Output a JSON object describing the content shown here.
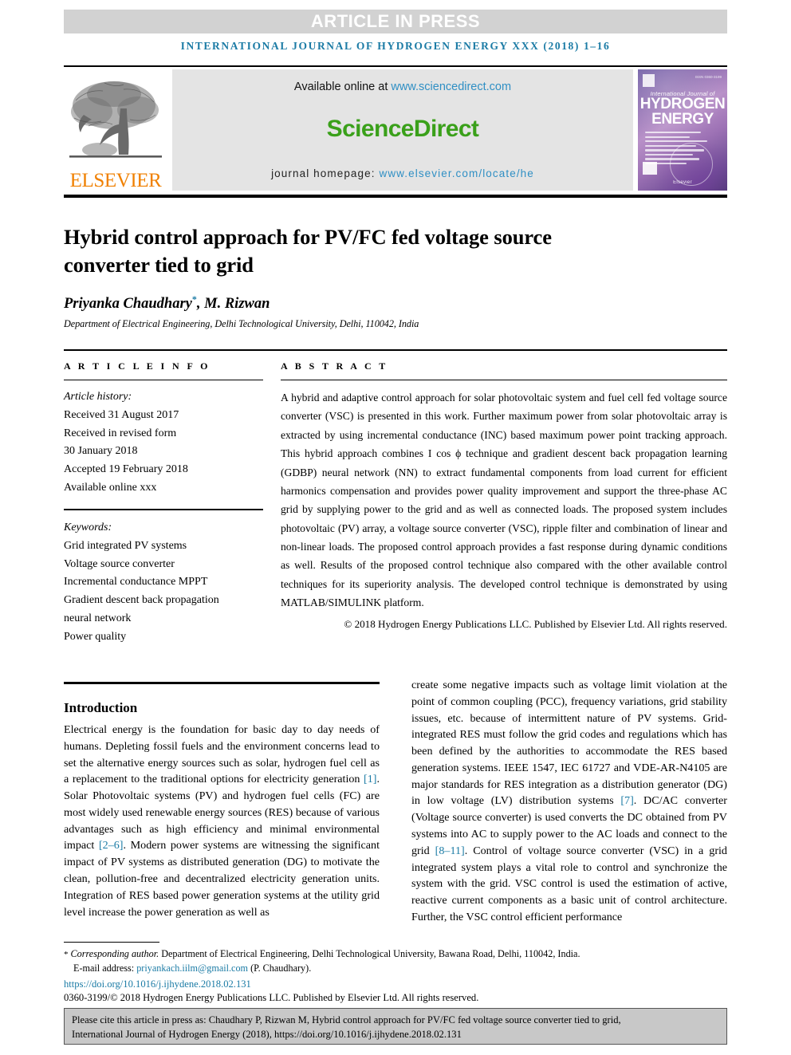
{
  "banner": {
    "press_label": "ARTICLE IN PRESS",
    "banner_color": "#d2d2d2"
  },
  "running_head": "INTERNATIONAL JOURNAL OF HYDROGEN ENERGY XXX (2018) 1–16",
  "masthead": {
    "publisher_wordmark": "ELSEVIER",
    "publisher_color": "#f08000",
    "available_prefix": "Available online at ",
    "available_url": "www.sciencedirect.com",
    "sciencedirect_wordmark": "ScienceDirect",
    "sciencedirect_color": "#3aa01a",
    "homepage_prefix": "journal homepage: ",
    "homepage_url": "www.elsevier.com/locate/he",
    "link_color": "#2f8fc4",
    "cover": {
      "line1": "International Journal of",
      "line2": "HYDROGEN",
      "line3": "ENERGY",
      "publisher": "Elsevier",
      "corner_code": "ISSN 0360-3199"
    }
  },
  "article": {
    "title": "Hybrid control approach for PV/FC fed voltage source converter tied to grid",
    "authors": "Priyanka Chaudhary",
    "corresponding_marker": "*",
    "authors_rest": ", M. Rizwan",
    "affiliation": "Department of Electrical Engineering, Delhi Technological University, Delhi, 110042, India"
  },
  "info": {
    "heading": "A R T I C L E   I N F O",
    "history_label": "Article history:",
    "history": [
      "Received 31 August 2017",
      "Received in revised form",
      "30 January 2018",
      "Accepted 19 February 2018",
      "Available online xxx"
    ],
    "keywords_label": "Keywords:",
    "keywords": [
      "Grid integrated PV systems",
      "Voltage source converter",
      "Incremental conductance MPPT",
      "Gradient descent back propagation",
      "neural network",
      "Power quality"
    ]
  },
  "abstract": {
    "heading": "A B S T R A C T",
    "body": "A hybrid and adaptive control approach for solar photovoltaic system and fuel cell fed voltage source converter (VSC) is presented in this work. Further maximum power from solar photovoltaic array is extracted by using incremental conductance (INC) based maximum power point tracking approach. This hybrid approach combines I cos ϕ technique and gradient descent back propagation learning (GDBP) neural network (NN) to extract fundamental components from load current for efficient harmonics compensation and provides power quality improvement and support the three-phase AC grid by supplying power to the grid and as well as connected loads. The proposed system includes photovoltaic (PV) array, a voltage source converter (VSC), ripple filter and combination of linear and non-linear loads. The proposed control approach provides a fast response during dynamic conditions as well. Results of the proposed control technique also compared with the other available control techniques for its superiority analysis. The developed control technique is demonstrated by using MATLAB/SIMULINK platform.",
    "copyright": "© 2018 Hydrogen Energy Publications LLC. Published by Elsevier Ltd. All rights reserved."
  },
  "introduction": {
    "heading": "Introduction",
    "left_part1": "Electrical energy is the foundation for basic day to day needs of humans. Depleting fossil fuels and the environment concerns lead to set the alternative energy sources such as solar, hydrogen fuel cell as a replacement to the traditional options for electricity generation ",
    "ref1": "[1]",
    "left_part2": ". Solar Photovoltaic systems (PV) and hydrogen fuel cells (FC) are most widely used renewable energy sources (RES) because of various advantages such as high efficiency and minimal environmental impact ",
    "ref2": "[2–6]",
    "left_part3": ". Modern power systems are witnessing the significant impact of PV systems as distributed generation (DG) to motivate the clean, pollution-free and decentralized electricity generation units. Integration of RES based power generation systems at the utility grid level increase the power generation as well as",
    "right_part1": "create some negative impacts such as voltage limit violation at the point of common coupling (PCC), frequency variations, grid stability issues, etc. because of intermittent nature of PV systems. Grid-integrated RES must follow the grid codes and regulations which has been defined by the authorities to accommodate the RES based generation systems. IEEE 1547, IEC 61727 and VDE-AR-N4105 are major standards for RES integration as a distribution generator (DG) in low voltage (LV) distribution systems ",
    "ref3": "[7]",
    "right_part2": ". DC/AC converter (Voltage source converter) is used converts the DC obtained from PV systems into AC to supply power to the AC loads and connect to the grid ",
    "ref4": "[8–11]",
    "right_part3": ". Control of voltage source converter (VSC) in a grid integrated system plays a vital role to control and synchronize the system with the grid. VSC control is used the estimation of active, reactive current components as a basic unit of control architecture. Further, the VSC control efficient performance"
  },
  "footer": {
    "corresponding_star": "*",
    "corresponding_label": "Corresponding author.",
    "corresponding_address": " Department of Electrical Engineering, Delhi Technological University, Bawana Road, Delhi, 110042, India.",
    "email_label": "E-mail address: ",
    "email": "priyankach.iilm@gmail.com",
    "email_owner": " (P. Chaudhary).",
    "doi": "https://doi.org/10.1016/j.ijhydene.2018.02.131",
    "issn_line": "0360-3199/© 2018 Hydrogen Energy Publications LLC. Published by Elsevier Ltd. All rights reserved.",
    "link_color": "#1b7ba5"
  },
  "cite_box": {
    "line1": "Please cite this article in press as: Chaudhary P, Rizwan M, Hybrid control approach for PV/FC fed voltage source converter tied to grid,",
    "line2": "International Journal of Hydrogen Energy (2018), https://doi.org/10.1016/j.ijhydene.2018.02.131",
    "background": "#c8c8c8"
  }
}
